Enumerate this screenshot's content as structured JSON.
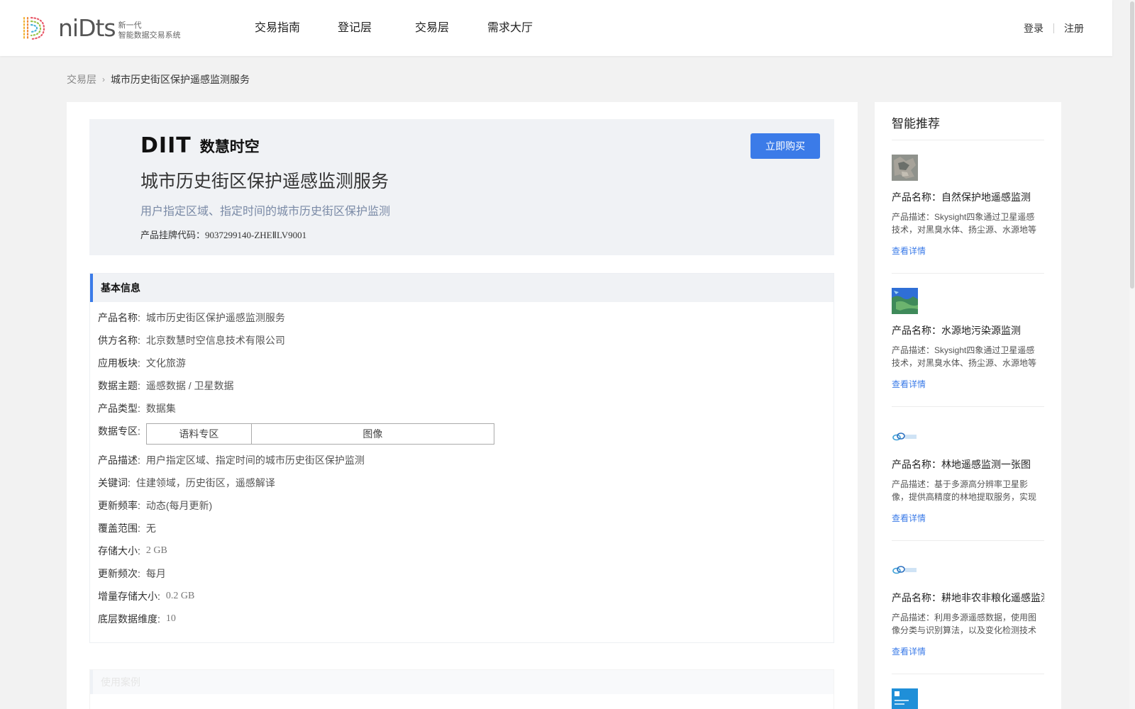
{
  "header": {
    "logo_text": "niDts",
    "logo_sub1": "新一代",
    "logo_sub2": "智能数据交易系统",
    "nav": [
      "交易指南",
      "登记层",
      "交易层",
      "需求大厅"
    ],
    "login": "登录",
    "register": "注册"
  },
  "breadcrumb": {
    "parent": "交易层",
    "current": "城市历史街区保护遥感监测服务"
  },
  "product": {
    "brand_logo": "DIIT",
    "brand_cn": "数慧时空",
    "title": "城市历史街区保护遥感监测服务",
    "description": "用户指定区域、指定时间的城市历史街区保护监测",
    "code_label": "产品挂牌代码：",
    "code": "9037299140-ZHEⅡLV9001",
    "buy_label": "立即购买"
  },
  "basic_info": {
    "heading": "基本信息",
    "rows": [
      {
        "key": "产品名称:",
        "value": "城市历史街区保护遥感监测服务"
      },
      {
        "key": "供方名称:",
        "value": "北京数慧时空信息技术有限公司"
      },
      {
        "key": "应用板块:",
        "value": "文化旅游"
      },
      {
        "key": "数据主题:",
        "value": "遥感数据 / 卫星数据"
      },
      {
        "key": "产品类型:",
        "value": "数据集"
      }
    ],
    "zone_label": "数据专区:",
    "zone_cells": [
      "语料专区",
      "图像"
    ],
    "rows2": [
      {
        "key": "产品描述:",
        "value": "用户指定区域、指定时间的城市历史街区保护监测"
      },
      {
        "key": "关键词:",
        "value": "住建领域，历史街区，遥感解译"
      },
      {
        "key": "更新频率:",
        "value": "动态(每月更新)"
      },
      {
        "key": "覆盖范围:",
        "value": "无"
      },
      {
        "key": "存储大小:",
        "value": "2 GB"
      },
      {
        "key": "更新频次:",
        "value": "每月"
      },
      {
        "key": "增量存储大小:",
        "value": "0.2 GB"
      },
      {
        "key": "底层数据维度:",
        "value": "10"
      }
    ]
  },
  "next_section": {
    "heading": "使用案例"
  },
  "sidebar": {
    "title": "智能推荐",
    "items": [
      {
        "name": "产品名称：自然保护地遥感监测",
        "desc": "产品描述：Skysight四象通过卫星遥感技术，对黑臭水体、扬尘源、水源地等进行监测",
        "link": "查看详情"
      },
      {
        "name": "产品名称：水源地污染源监测",
        "desc": "产品描述：Skysight四象通过卫星遥感技术，对黑臭水体、扬尘源、水源地等进行监测",
        "link": "查看详情"
      },
      {
        "name": "产品名称：林地遥感监测一张图",
        "desc": "产品描述：基于多源高分辨率卫星影像，提供高精度的林地提取服务，实现林地监测",
        "link": "查看详情"
      },
      {
        "name": "产品名称：耕地非农非粮化遥感监测",
        "desc": "产品描述：利用多源遥感数据，使用图像分类与识别算法，以及变化检测技术进行监测",
        "link": "查看详情"
      }
    ]
  },
  "colors": {
    "accent": "#3b7be8",
    "page_bg": "#f2f2f2",
    "hero_bg": "#f0f2f5"
  }
}
